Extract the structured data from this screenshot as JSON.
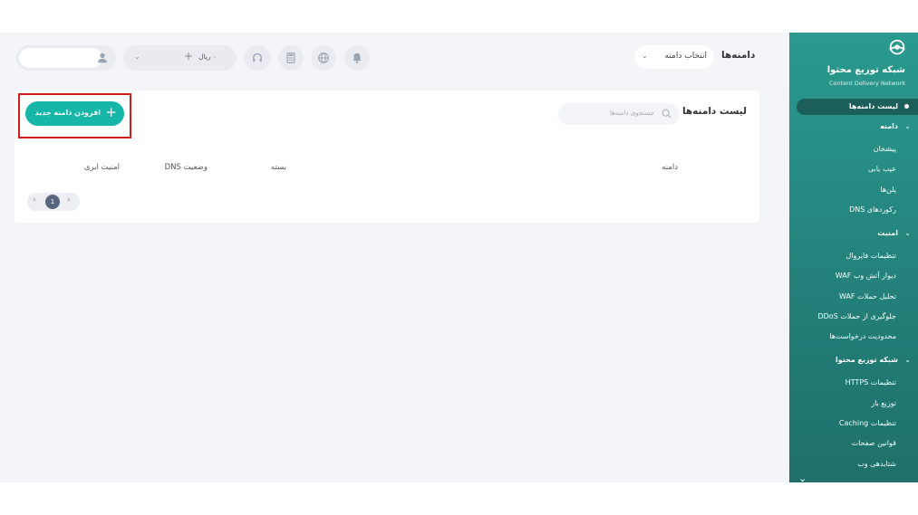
{
  "sidebar": {
    "brand_title": "شبکه توزیع محتوا",
    "brand_subtitle": "Content Delivery Network",
    "active_item": "لیست دامنه‌ها",
    "domain_group": "دامنه",
    "domain_items": [
      "پیشخان",
      "عیب یابی",
      "پلن‌ها",
      "رکوردهای DNS"
    ],
    "security_group": "امنیت",
    "security_items": [
      "تنظیمات فایروال",
      "دیوار آتش وب WAF",
      "تحلیل حملات WAF",
      "جلوگیری از حملات DDoS",
      "محدودیت درخواست‌ها"
    ],
    "cdn_group": "شبکه توزیع محتوا",
    "cdn_items": [
      "تنظیمات HTTPS",
      "توزیع بار",
      "تنظیمات Caching",
      "قوانین صفحات",
      "شتابدهی وب"
    ]
  },
  "header": {
    "title": "دامنه‌ها",
    "domain_select_label": "انتخاب دامنه",
    "wallet_amount": "۰ ریال",
    "user_name": ""
  },
  "card": {
    "title": "لیست دامنه‌ها",
    "search_placeholder": "جستجوی دامنه‌ها",
    "add_button_label": "افزودن دامنه جدید",
    "columns": [
      "دامنه",
      "بسته",
      "وضعیت DNS",
      "امنیت ابری"
    ],
    "current_page": "1"
  },
  "colors": {
    "sidebar": "#237f79",
    "accent": "#16b7a8",
    "highlight": "#d11a1a",
    "background": "#f4f5f8"
  }
}
